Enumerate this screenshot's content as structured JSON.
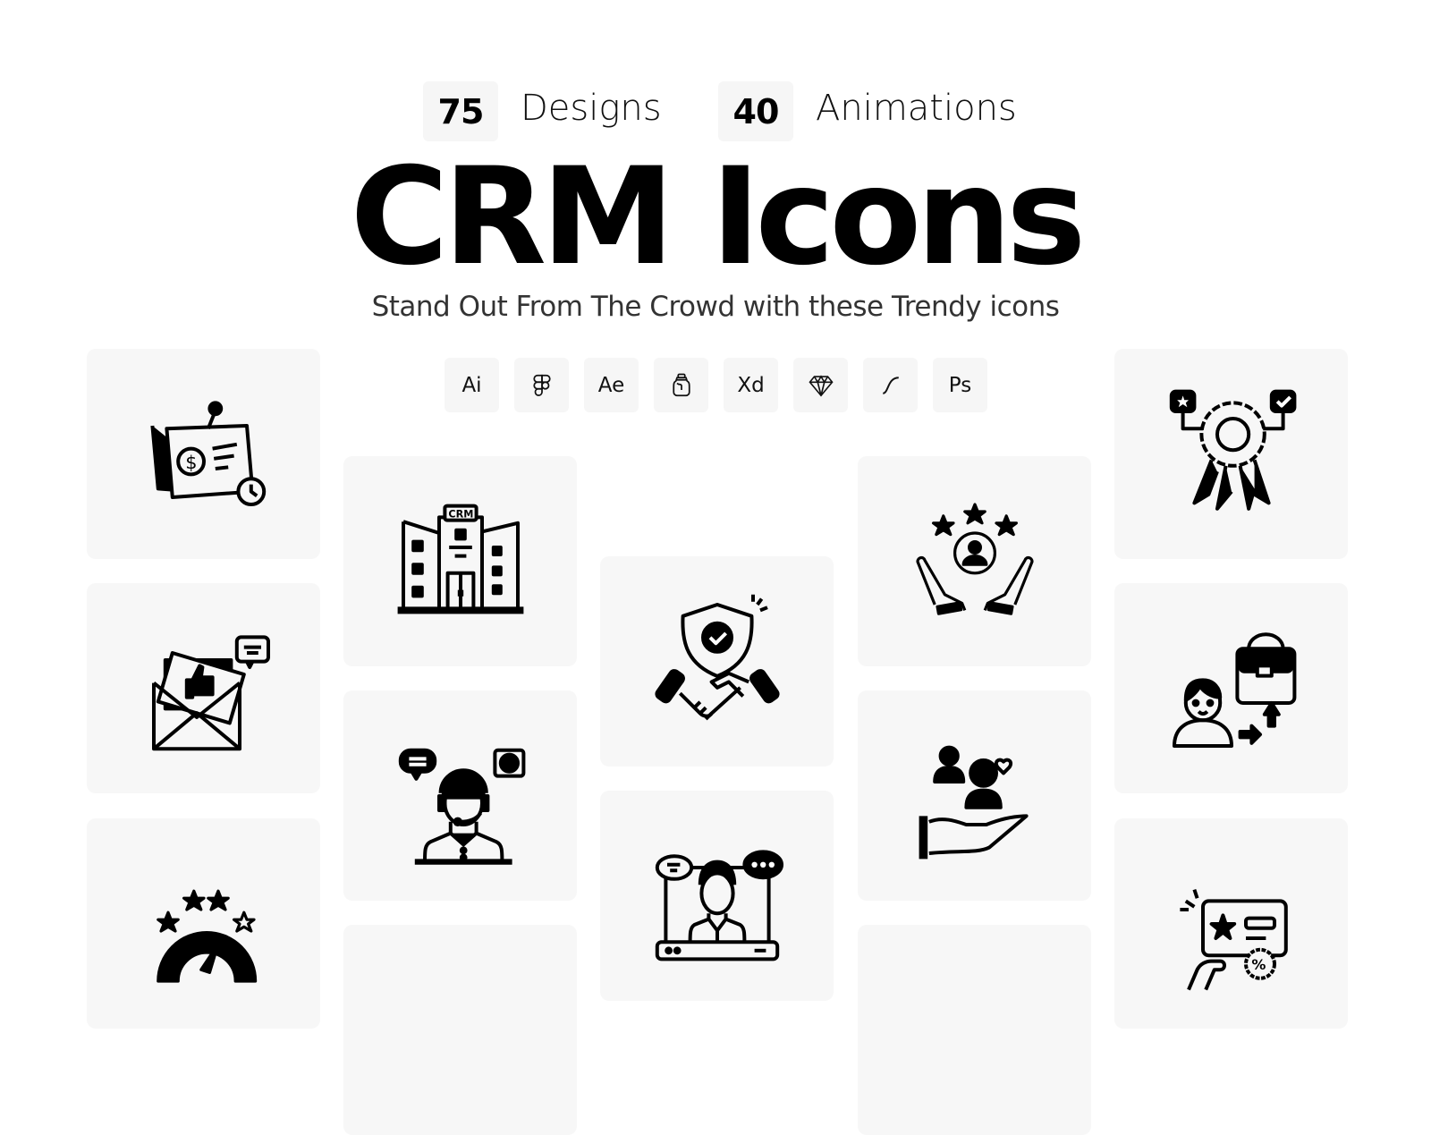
{
  "stats": [
    {
      "value": "75",
      "label": "Designs"
    },
    {
      "value": "40",
      "label": "Animations"
    }
  ],
  "title": "CRM Icons",
  "subtitle": "Stand Out From The Crowd with these Trendy icons",
  "tools": [
    {
      "label": "Ai",
      "icon": "illustrator"
    },
    {
      "label": "",
      "icon": "figma-icon"
    },
    {
      "label": "Ae",
      "icon": "after-effects"
    },
    {
      "label": "",
      "icon": "iconjar-icon"
    },
    {
      "label": "Xd",
      "icon": "adobe-xd"
    },
    {
      "label": "",
      "icon": "sketch-icon"
    },
    {
      "label": "",
      "icon": "lottie-icon"
    },
    {
      "label": "Ps",
      "icon": "photoshop"
    }
  ],
  "icons": [
    {
      "name": "invoice-reminder-icon"
    },
    {
      "name": "crm-building-icon"
    },
    {
      "name": "trusted-deal-icon"
    },
    {
      "name": "customer-rating-icon"
    },
    {
      "name": "quality-badge-icon"
    },
    {
      "name": "feedback-mail-icon"
    },
    {
      "name": "customer-support-icon"
    },
    {
      "name": "customer-care-icon"
    },
    {
      "name": "job-promotion-icon"
    },
    {
      "name": "satisfaction-meter-icon"
    },
    {
      "name": "video-consultation-icon"
    },
    {
      "name": "loyalty-card-icon"
    }
  ],
  "crm_label": "CRM",
  "percent_label": "%"
}
